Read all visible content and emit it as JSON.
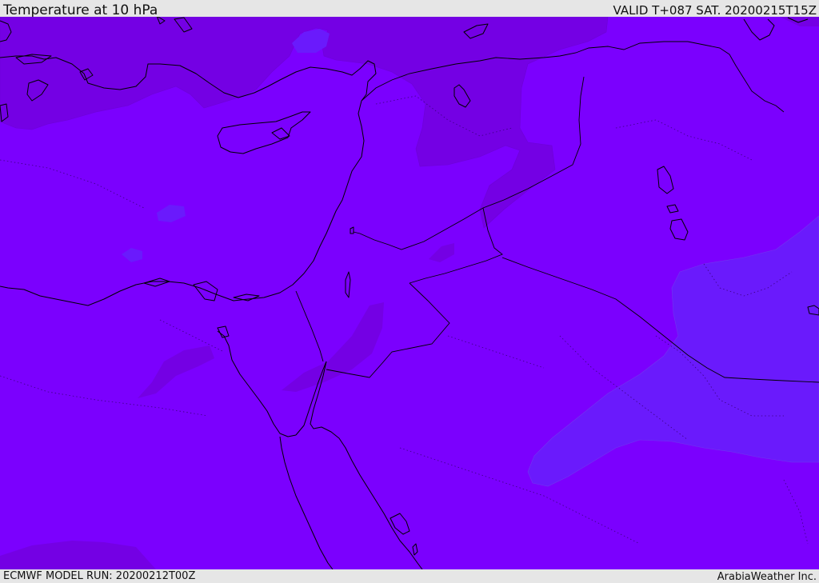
{
  "header": {
    "title": "Temperature at 10 hPa",
    "valid": "VALID T+087 SAT. 20200215T15Z"
  },
  "footer": {
    "model_run": "ECMWF MODEL RUN: 20200212T00Z",
    "credit": "ArabiaWeather Inc."
  },
  "colors": {
    "base_fill": "#7b00fe",
    "warmer_shade": "#7400e4",
    "cooler_shade": "#6a1afc",
    "coastline": "#000000",
    "frame": "#e6e6e6"
  }
}
